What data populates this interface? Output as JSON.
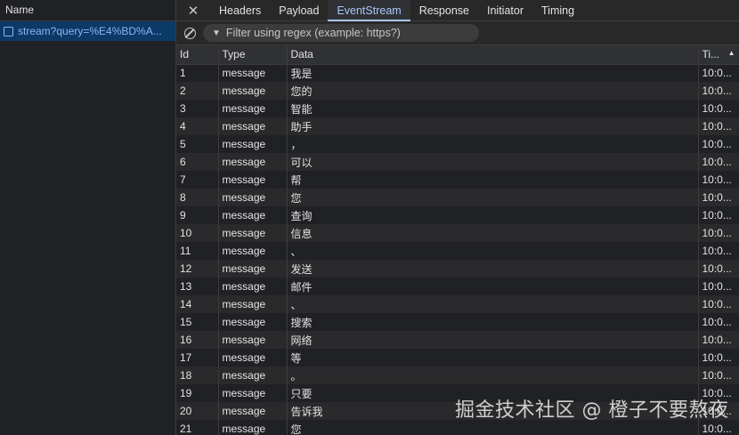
{
  "left": {
    "header": "Name",
    "request": "stream?query=%E4%BD%A..."
  },
  "tabs": [
    "Headers",
    "Payload",
    "EventStream",
    "Response",
    "Initiator",
    "Timing"
  ],
  "active_tab": "EventStream",
  "filter": {
    "placeholder": "Filter using regex (example: https?)"
  },
  "table": {
    "headers": {
      "id": "Id",
      "type": "Type",
      "data": "Data",
      "time": "Ti..."
    },
    "rows": [
      {
        "id": "1",
        "type": "message",
        "data": "我是",
        "time": "10:0..."
      },
      {
        "id": "2",
        "type": "message",
        "data": "您的",
        "time": "10:0..."
      },
      {
        "id": "3",
        "type": "message",
        "data": "智能",
        "time": "10:0..."
      },
      {
        "id": "4",
        "type": "message",
        "data": "助手",
        "time": "10:0..."
      },
      {
        "id": "5",
        "type": "message",
        "data": "，",
        "time": "10:0..."
      },
      {
        "id": "6",
        "type": "message",
        "data": "可以",
        "time": "10:0..."
      },
      {
        "id": "7",
        "type": "message",
        "data": "帮",
        "time": "10:0..."
      },
      {
        "id": "8",
        "type": "message",
        "data": "您",
        "time": "10:0..."
      },
      {
        "id": "9",
        "type": "message",
        "data": "查询",
        "time": "10:0..."
      },
      {
        "id": "10",
        "type": "message",
        "data": "信息",
        "time": "10:0..."
      },
      {
        "id": "11",
        "type": "message",
        "data": "、",
        "time": "10:0..."
      },
      {
        "id": "12",
        "type": "message",
        "data": "发送",
        "time": "10:0..."
      },
      {
        "id": "13",
        "type": "message",
        "data": "邮件",
        "time": "10:0..."
      },
      {
        "id": "14",
        "type": "message",
        "data": "、",
        "time": "10:0..."
      },
      {
        "id": "15",
        "type": "message",
        "data": "搜索",
        "time": "10:0..."
      },
      {
        "id": "16",
        "type": "message",
        "data": "网络",
        "time": "10:0..."
      },
      {
        "id": "17",
        "type": "message",
        "data": "等",
        "time": "10:0..."
      },
      {
        "id": "18",
        "type": "message",
        "data": "。",
        "time": "10:0..."
      },
      {
        "id": "19",
        "type": "message",
        "data": "只要",
        "time": "10:0..."
      },
      {
        "id": "20",
        "type": "message",
        "data": "告诉我",
        "time": "10:0..."
      },
      {
        "id": "21",
        "type": "message",
        "data": "您",
        "time": "10:0..."
      }
    ]
  },
  "watermark": "掘金技术社区 @ 橙子不要熬夜",
  "colors": {
    "accent": "#a8c7fa",
    "selected_row": "#0b3a66",
    "background": "#202124"
  }
}
